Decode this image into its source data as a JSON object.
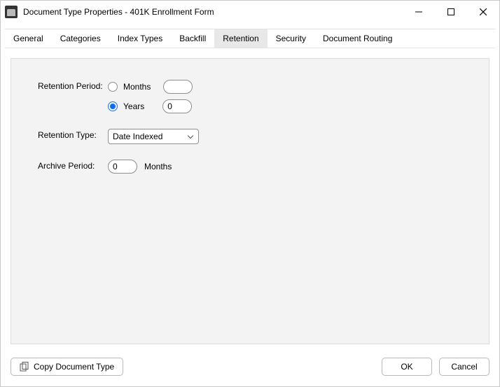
{
  "window": {
    "title": "Document Type Properties  - 401K Enrollment Form"
  },
  "tabs": {
    "t0": "General",
    "t1": "Categories",
    "t2": "Index Types",
    "t3": "Backfill",
    "t4": "Retention",
    "t5": "Security",
    "t6": "Document Routing"
  },
  "retention": {
    "period_label": "Retention Period:",
    "months_label": "Months",
    "years_label": "Years",
    "months_value": "",
    "years_value": "0",
    "type_label": "Retention Type:",
    "type_value": "Date Indexed",
    "archive_label": "Archive Period:",
    "archive_value": "0",
    "archive_unit": "Months"
  },
  "footer": {
    "copy": "Copy Document Type",
    "ok": "OK",
    "cancel": "Cancel"
  }
}
